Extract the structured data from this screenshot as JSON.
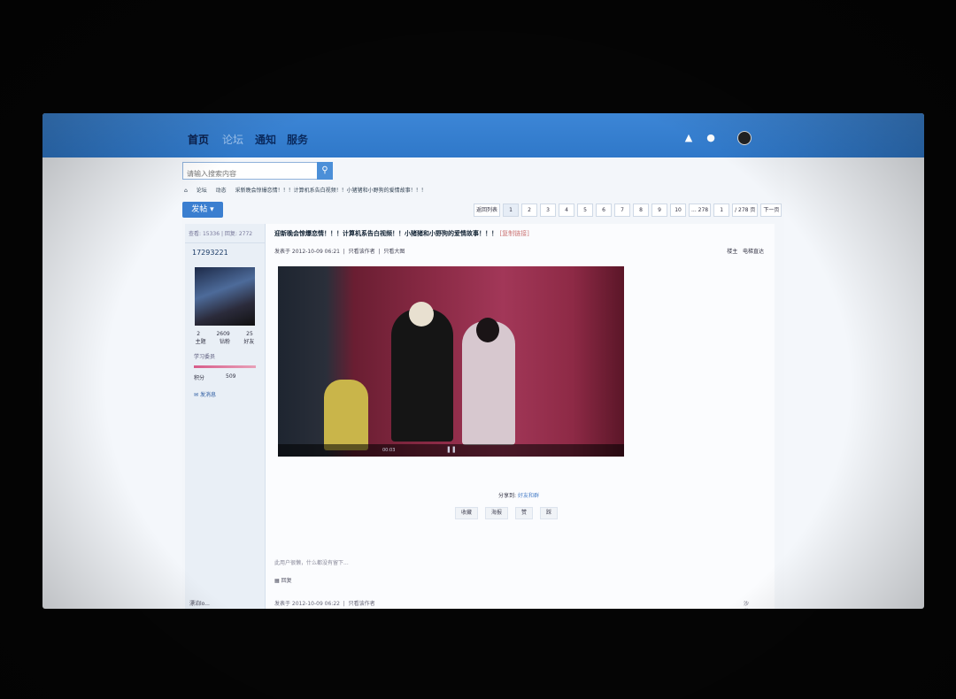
{
  "nav": {
    "home": "首页",
    "forum": "论坛",
    "notify": "通知",
    "service": "服务"
  },
  "search": {
    "placeholder": "请输入搜索内容"
  },
  "breadcrumb": {
    "forum": "论坛",
    "dynamic": "动态",
    "thread": "采新晚会惊爆恋情！！！计算机系告白视频！！小猪猪和小野狗的爱情故事！！！"
  },
  "post_button": "发帖",
  "pager": {
    "back": "返回列表",
    "pages": [
      "1",
      "2",
      "3",
      "4",
      "5",
      "6",
      "7",
      "8",
      "9",
      "10",
      "... 278"
    ],
    "current_input": "1",
    "total": "/ 278 页",
    "next": "下一页"
  },
  "sidebar": {
    "views_label": "查看:",
    "views": "15336",
    "replies_label": "回复:",
    "replies": "2772",
    "uid": "17293221",
    "stats": [
      {
        "value": "2",
        "label": "主题"
      },
      {
        "value": "2609",
        "label": "钻粉"
      },
      {
        "value": "25",
        "label": "好友"
      }
    ],
    "level": "学习委员",
    "score_label": "积分",
    "score": "509",
    "message": "发消息"
  },
  "post": {
    "title": "迎新晚会惊爆恋情！！！计算机系告白视频！！小猪猪和小野狗的爱情故事！！！",
    "copy_link": "[复制链接]",
    "posted_at": "发表于 2012-10-09 06:21",
    "only_author": "只看该作者",
    "only_big_image": "只看大图",
    "floor": "楼主",
    "elevator": "电梯直达"
  },
  "video": {
    "time": "00:03"
  },
  "share": {
    "label": "分享到:",
    "target": "好友和群"
  },
  "actions": {
    "collect": "收藏",
    "like_share": "海报",
    "support": "赞",
    "oppose": "踩"
  },
  "signature": "此用户很懒，什么都没有留下...",
  "reply": "回复",
  "next_post": {
    "author": "漂泊lo...",
    "posted_at": "发表于 2012-10-09 06:22",
    "only_author": "只看该作者",
    "floor": "沙发"
  },
  "colors": {
    "topbar": "#2f78c9",
    "accent": "#3b7fd0"
  }
}
